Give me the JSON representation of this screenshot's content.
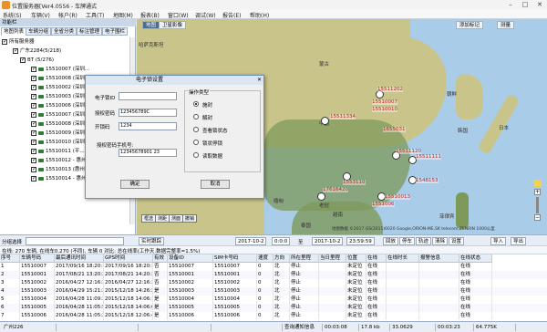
{
  "window": {
    "title": "位置服务器[Ver4.0556 - 车牌通式"
  },
  "menu": [
    "系统(S)",
    "车辆(V)",
    "帐户(R)",
    "工具(T)",
    "地图(M)",
    "报表(B)",
    "窗口(W)",
    "调试(W)",
    "报告(E)",
    "帮助(H)"
  ],
  "left": {
    "header": "功能栏",
    "tabs": [
      "地图列表",
      "车辆分组",
      "全省分类",
      "标注管理",
      "电子围栏"
    ],
    "root": "所有服务器",
    "group1": "广东2284(5/218)",
    "group2": "BT (5/276)",
    "vehicles": [
      "15510007 (深圳...",
      "15510008 (深圳...",
      "15510002 (深圳...",
      "15510003 (深圳...",
      "15510006 (深圳...",
      "15510007 (深圳...",
      "15510008 (深圳...",
      "15510009 (深圳...",
      "15510010 (深圳...",
      "15510011 (平...",
      "15510012 - 惠州 (542 天)",
      "15510013 (惠州542天)",
      "15510014 - 惠州(542天)"
    ]
  },
  "map": {
    "tabs": [
      "地图",
      "卫星影像"
    ],
    "right_tabs": [
      "添加标记",
      "测量"
    ],
    "labels": [
      "15511202",
      "15510007",
      "15510010",
      "1655031",
      "15511334",
      "15511120",
      "17616420",
      "1553110",
      "15511111",
      "1548153",
      "1551006",
      "15510013"
    ],
    "countries": [
      "哈萨克斯坦",
      "蒙古",
      "中国",
      "日本",
      "朝鲜",
      "韩国",
      "印度",
      "缅甸",
      "泰国",
      "越南",
      "菲律宾",
      "老挝"
    ],
    "tools": [
      "框选",
      "测距",
      "测面",
      "撤销"
    ],
    "copyright": "地图数据 ©2017 GS(2011)6020 Google,ORION-ME,SK telecom,ZENRIN 1000公里"
  },
  "dialog": {
    "title": "电子锁设置",
    "fields": [
      {
        "label": "电子锁ID",
        "value": ""
      },
      {
        "label": "授权密码",
        "value": "123456789C"
      },
      {
        "label": "开锁码",
        "value": "1234"
      },
      {
        "label": "授权密码手机号:",
        "value": ""
      },
      {
        "label": "",
        "value": "12345678901 23"
      }
    ],
    "op_title": "操作类型",
    "options": [
      "施封",
      "解封",
      "查看锁状态",
      "锁状停锁",
      "读取数据"
    ],
    "selected": 0,
    "ok": "确定",
    "cancel": "取消"
  },
  "toolbar": {
    "select_label": "分组选择",
    "select_value": "实时跟踪",
    "date_from": "2017-10-2",
    "time_from": "0:0:0",
    "to": "至",
    "date_to": "2017-10-2",
    "time_to": "23:59:59",
    "buttons": [
      "回放",
      "停车",
      "轨迹",
      "清除",
      "设置"
    ],
    "right_buttons": [
      "导入",
      "导出"
    ]
  },
  "strip": "在线: 270 车辆, 在线车0.270 (不同), 车辆 0 对比: 总在线率(工作天.数据完整率=1.5%)",
  "table": {
    "headers": [
      "序号",
      "车辆号码",
      "最后通讯时间",
      "GPS时间",
      "有效",
      "设备ID",
      "SIM卡号码",
      "速度",
      "方向",
      "所在里程",
      "当日里程",
      "位置",
      "在线",
      "在线时长",
      "报警信息",
      "在线状态"
    ],
    "rows": [
      [
        "1",
        "15510007",
        "2017/09/16 18:20:13",
        "2017/09/16 18:20:13",
        "否",
        "15510007",
        "15510007",
        "0",
        "北",
        "停止",
        "",
        "未定位",
        "在线",
        "",
        "",
        "在线"
      ],
      [
        "2",
        "15510001",
        "2017/08/21 13:20:37",
        "2017/08/21 14:20:37",
        "否",
        "15510001",
        "15510001",
        "0",
        "北",
        "停止",
        "",
        "未定位",
        "在线",
        "",
        "",
        "在线"
      ],
      [
        "3",
        "15510002",
        "2016/04/27 12:16:38",
        "2016/04/27 12:16:38",
        "否",
        "15510002",
        "15510002",
        "0",
        "北",
        "停止",
        "",
        "未定位",
        "在线",
        "",
        "",
        "在线"
      ],
      [
        "4",
        "15510003",
        "2016/04/29 15:21:37",
        "2015/12/18 14:26:26",
        "是",
        "15510003",
        "15510003",
        "0",
        "北",
        "停止",
        "",
        "未定位",
        "在线",
        "",
        "",
        "在线"
      ],
      [
        "5",
        "15510004",
        "2016/04/28 11:09:37",
        "2015/12/18 14:06:18",
        "是",
        "15510004",
        "15510004",
        "0",
        "北",
        "停止",
        "",
        "未定位",
        "在线",
        "",
        "",
        "在线"
      ],
      [
        "6",
        "15510005",
        "2016/04/28 11:05:59",
        "2015/12/18 14:06:03",
        "是",
        "15510005",
        "15510005",
        "0",
        "北",
        "停止",
        "",
        "未定位",
        "在线",
        "",
        "",
        "在线"
      ],
      [
        "7",
        "15510006",
        "2016/04/28 11:05:26",
        "2015/12/18 12:06:48",
        "是",
        "15510006",
        "15510006",
        "0",
        "北",
        "停止",
        "",
        "未定位",
        "在线",
        "",
        "",
        "在线"
      ]
    ]
  },
  "status": [
    "广州226",
    "",
    "",
    "",
    "查询通知信息",
    "00:03:08",
    "17.8 kb",
    "33.0629",
    "00:03:23",
    "64.775K"
  ]
}
